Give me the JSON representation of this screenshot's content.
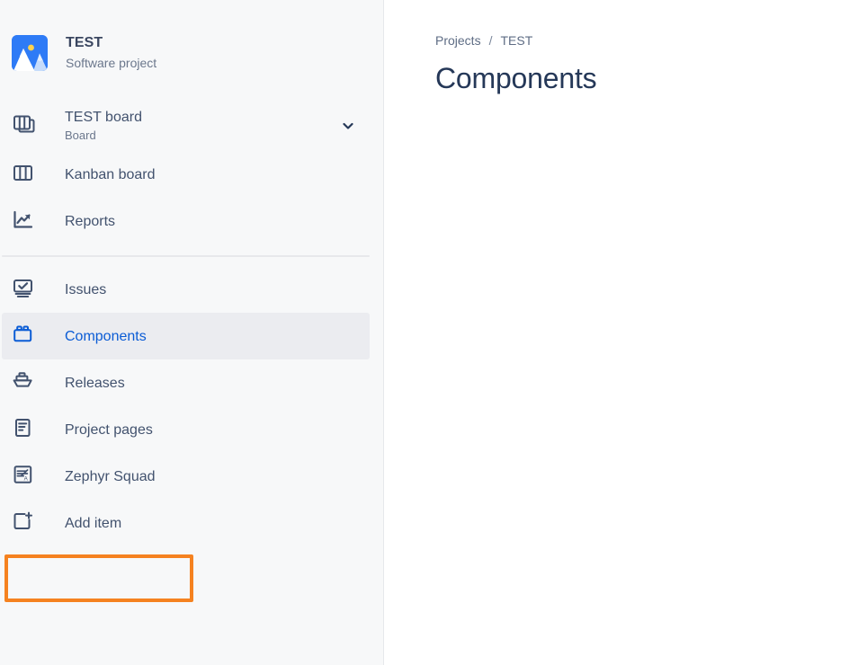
{
  "sidebar": {
    "project": {
      "name": "TEST",
      "type": "Software project",
      "avatar_icon": "mountain-image-icon",
      "avatar_color": "#2E7BF6"
    },
    "board_item": {
      "label": "TEST board",
      "sublabel": "Board",
      "icon": "stacked-board-icon",
      "chevron_icon": "chevron-down-icon"
    },
    "items_top": [
      {
        "label": "Kanban board",
        "icon": "board-icon",
        "selected": false
      },
      {
        "label": "Reports",
        "icon": "trend-chart-icon",
        "selected": false
      }
    ],
    "items_bottom": [
      {
        "label": "Issues",
        "icon": "issues-checkmark-icon",
        "selected": false
      },
      {
        "label": "Components",
        "icon": "component-brick-icon",
        "selected": true
      },
      {
        "label": "Releases",
        "icon": "ship-icon",
        "selected": false
      },
      {
        "label": "Project pages",
        "icon": "page-lines-icon",
        "selected": false
      },
      {
        "label": "Zephyr Squad",
        "icon": "zephyr-wing-icon",
        "selected": false
      },
      {
        "label": "Add item",
        "icon": "add-square-plus-icon",
        "selected": false
      }
    ],
    "selected_color": "#0B5CD5",
    "selected_bg": "#EBECF0",
    "annotation_color": "#F58220",
    "annotated_item": "Zephyr Squad"
  },
  "main": {
    "breadcrumb": {
      "root": "Projects",
      "separator": "/",
      "current": "TEST"
    },
    "title": "Components"
  }
}
